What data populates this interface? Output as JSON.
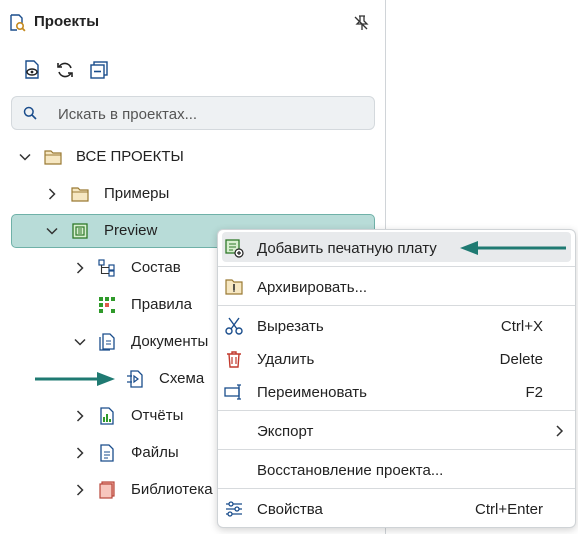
{
  "panel": {
    "title": "Проекты",
    "title_icon": "project-search-icon",
    "pin_icon": "pin-off-icon",
    "toolbar": [
      "show-icon",
      "refresh-icon",
      "collapse-all-icon"
    ],
    "search": {
      "placeholder": "Искать в проектах...",
      "value": ""
    }
  },
  "tree": [
    {
      "label": "ВСЕ ПРОЕКТЫ",
      "icon": "folder-icon",
      "expanded": true
    },
    {
      "label": "Примеры",
      "icon": "folder-icon",
      "expanded": false
    },
    {
      "label": "Preview",
      "icon": "pcb-project-icon",
      "expanded": true,
      "selected": true
    },
    {
      "label": "Состав",
      "icon": "structure-icon",
      "expanded": false
    },
    {
      "label": "Правила",
      "icon": "rules-icon"
    },
    {
      "label": "Документы",
      "icon": "documents-icon",
      "expanded": true
    },
    {
      "label": "Схема",
      "icon": "schematic-icon"
    },
    {
      "label": "Отчёты",
      "icon": "reports-icon",
      "expanded": false
    },
    {
      "label": "Файлы",
      "icon": "files-icon",
      "expanded": false
    },
    {
      "label": "Библиотека",
      "icon": "library-icon",
      "expanded": false
    }
  ],
  "context_menu": {
    "items": [
      {
        "label": "Добавить печатную плату",
        "shortcut": "",
        "icon": "add-pcb-icon",
        "highlighted": true
      },
      {
        "label": "Архивировать...",
        "shortcut": "",
        "icon": "archive-icon"
      },
      {
        "label": "Вырезать",
        "shortcut": "Ctrl+X",
        "icon": "scissors-icon"
      },
      {
        "label": "Удалить",
        "shortcut": "Delete",
        "icon": "trash-icon"
      },
      {
        "label": "Переименовать",
        "shortcut": "F2",
        "icon": "rename-icon"
      },
      {
        "label": "Экспорт",
        "shortcut": "",
        "icon": "",
        "submenu": true
      },
      {
        "label": "Восстановление проекта...",
        "shortcut": "",
        "icon": ""
      },
      {
        "label": "Свойства",
        "shortcut": "Ctrl+Enter",
        "icon": "properties-icon"
      }
    ]
  },
  "colors": {
    "accent": "#1f7a72",
    "selection": "#b8dcd8",
    "selection_border": "#6fb1a8"
  }
}
